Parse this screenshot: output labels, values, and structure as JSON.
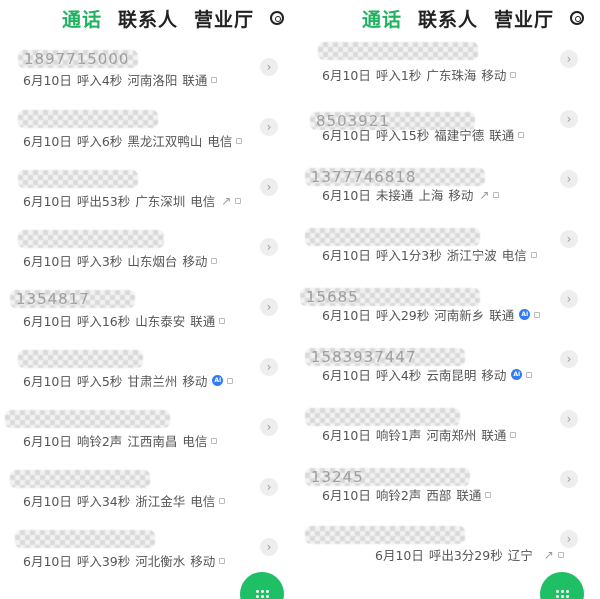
{
  "tabs": {
    "calls": "通话",
    "contacts": "联系人",
    "business": "营业厅"
  },
  "left": {
    "rows": [
      {
        "number": "1897715000",
        "date": "6月10日",
        "status": "呼入4秒",
        "location": "河南洛阳",
        "carrier": "联通",
        "outgoing": false,
        "ai": false
      },
      {
        "number": "",
        "date": "6月10日",
        "status": "呼入6秒",
        "location": "黑龙江双鸭山",
        "carrier": "电信",
        "outgoing": false,
        "ai": false
      },
      {
        "number": "",
        "date": "6月10日",
        "status": "呼出53秒",
        "location": "广东深圳",
        "carrier": "电信",
        "outgoing": true,
        "ai": false
      },
      {
        "number": "",
        "date": "6月10日",
        "status": "呼入3秒",
        "location": "山东烟台",
        "carrier": "移动",
        "outgoing": false,
        "ai": false
      },
      {
        "number": "1354817",
        "date": "6月10日",
        "status": "呼入16秒",
        "location": "山东泰安",
        "carrier": "联通",
        "outgoing": false,
        "ai": false
      },
      {
        "number": "",
        "date": "6月10日",
        "status": "呼入5秒",
        "location": "甘肃兰州",
        "carrier": "移动",
        "outgoing": false,
        "ai": true
      },
      {
        "number": "",
        "date": "6月10日",
        "status": "响铃2声",
        "location": "江西南昌",
        "carrier": "电信",
        "outgoing": false,
        "ai": false
      },
      {
        "number": "",
        "date": "6月10日",
        "status": "呼入34秒",
        "location": "浙江金华",
        "carrier": "电信",
        "outgoing": false,
        "ai": false
      },
      {
        "number": "",
        "date": "6月10日",
        "status": "呼入39秒",
        "location": "河北衡水",
        "carrier": "移动",
        "outgoing": false,
        "ai": false
      }
    ]
  },
  "right": {
    "rows": [
      {
        "number": "",
        "date": "6月10日",
        "status": "呼入1秒",
        "location": "广东珠海",
        "carrier": "移动",
        "outgoing": false,
        "ai": false
      },
      {
        "number": "8503921",
        "date": "6月10日",
        "status": "呼入15秒",
        "location": "福建宁德",
        "carrier": "联通",
        "outgoing": false,
        "ai": false
      },
      {
        "number": "1377746818",
        "date": "6月10日",
        "status": "未接通",
        "location": "上海",
        "carrier": "移动",
        "outgoing": true,
        "ai": false
      },
      {
        "number": "",
        "date": "6月10日",
        "status": "呼入1分3秒",
        "location": "浙江宁波",
        "carrier": "电信",
        "outgoing": false,
        "ai": false
      },
      {
        "number": "15685",
        "date": "6月10日",
        "status": "呼入29秒",
        "location": "河南新乡",
        "carrier": "联通",
        "outgoing": false,
        "ai": true
      },
      {
        "number": "1583937447",
        "date": "6月10日",
        "status": "呼入4秒",
        "location": "云南昆明",
        "carrier": "移动",
        "outgoing": false,
        "ai": true
      },
      {
        "number": "",
        "date": "6月10日",
        "status": "响铃1声",
        "location": "河南郑州",
        "carrier": "联通",
        "outgoing": false,
        "ai": false
      },
      {
        "number": "13245",
        "date": "6月10日",
        "status": "响铃2声",
        "location": "西部",
        "carrier": "联通",
        "outgoing": false,
        "ai": false
      },
      {
        "number": "",
        "date": "6月10日",
        "status": "呼出3分29秒",
        "location": "辽宁",
        "carrier": "",
        "outgoing": true,
        "ai": false
      }
    ]
  },
  "ai_badge": "AI",
  "icons": {
    "settings": "settings-icon",
    "chevron": "chevron-right-icon",
    "dialpad": "dialpad-icon",
    "outgoing": "outgoing-call-icon",
    "info": "info-icon"
  },
  "colors": {
    "accent": "#1fb15f",
    "fab": "#1fbf66",
    "ai": "#2f7cf6"
  }
}
